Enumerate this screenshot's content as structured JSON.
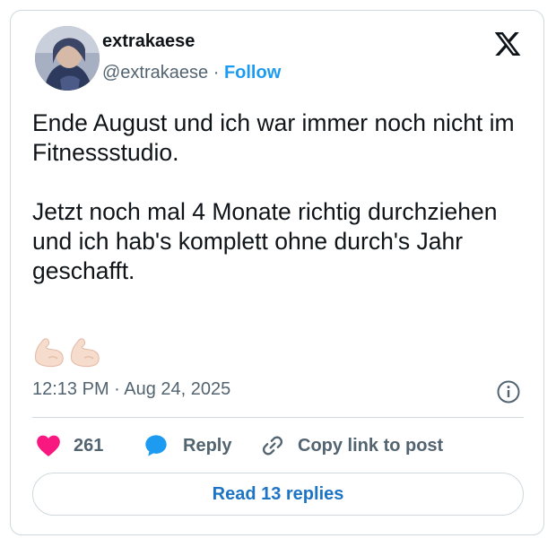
{
  "author": {
    "display_name": "extrakaese",
    "handle": "@extrakaese",
    "separator": "·",
    "follow_label": "Follow"
  },
  "tweet": {
    "paragraph_1": "Ende August und ich war immer noch nicht im Fitnessstudio.",
    "paragraph_2": "Jetzt noch mal 4 Monate richtig durchziehen und ich hab's komplett ohne durch's Jahr geschafft.",
    "emoji": [
      "flexed-biceps-light",
      "flexed-biceps-light"
    ],
    "timestamp": "12:13 PM · Aug 24, 2025"
  },
  "actions": {
    "like_count": "261",
    "reply_label": "Reply",
    "copy_link_label": "Copy link to post",
    "read_replies_label": "Read 13 replies"
  },
  "colors": {
    "like": "#f91880",
    "reply": "#1d9bf0",
    "follow": "#1d9bf0",
    "read_replies": "#1d74c4",
    "muted_text": "#536471",
    "border": "#cfd9de"
  },
  "icons": {
    "brand": "x-logo-icon",
    "like": "heart-icon",
    "reply": "speech-bubble-icon",
    "copy": "link-icon",
    "info": "info-icon"
  }
}
